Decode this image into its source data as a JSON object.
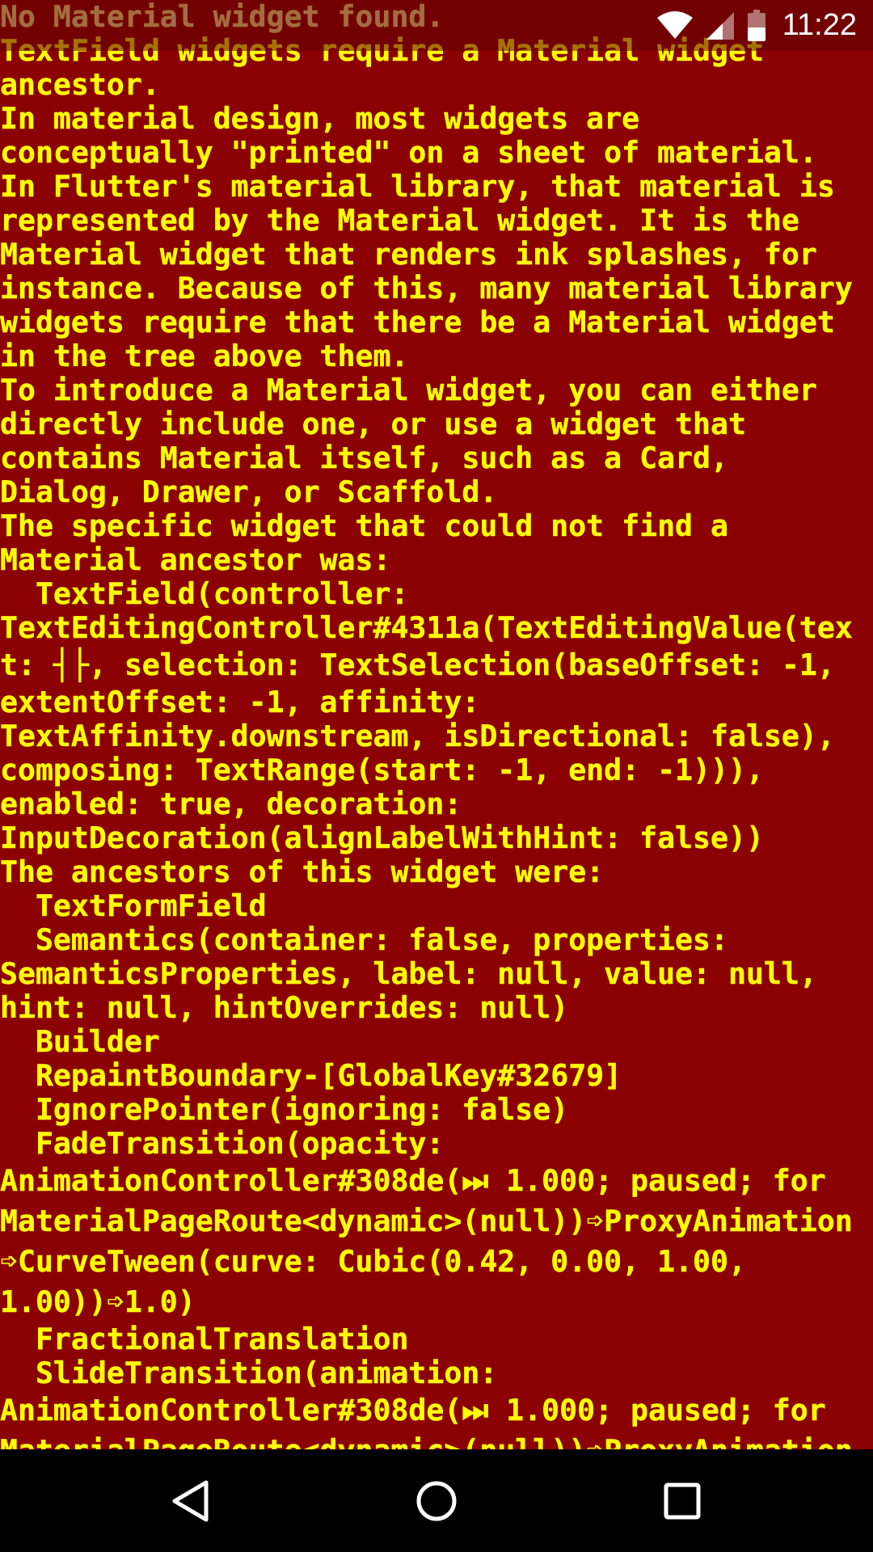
{
  "status_bar": {
    "time": "11:22",
    "icons": [
      "wifi-icon",
      "cell-signal-icon",
      "battery-icon"
    ]
  },
  "error": {
    "lines": [
      "No Material widget found.",
      "TextField widgets require a Material widget",
      "ancestor.",
      "In material design, most widgets are",
      "conceptually \"printed\" on a sheet of material.",
      "In Flutter's material library, that material is",
      "represented by the Material widget. It is the",
      "Material widget that renders ink splashes, for",
      "instance. Because of this, many material library",
      "widgets require that there be a Material widget",
      "in the tree above them.",
      "To introduce a Material widget, you can either",
      "directly include one, or use a widget that",
      "contains Material itself, such as a Card,",
      "Dialog, Drawer, or Scaffold.",
      "The specific widget that could not find a",
      "Material ancestor was:",
      "  TextField(controller:",
      "TextEditingController#4311a(TextEditingValue(tex",
      "t: ┤├, selection: TextSelection(baseOffset: -1,",
      "extentOffset: -1, affinity:",
      "TextAffinity.downstream, isDirectional: false),",
      "composing: TextRange(start: -1, end: -1))),",
      "enabled: true, decoration:",
      "InputDecoration(alignLabelWithHint: false))",
      "The ancestors of this widget were:",
      "  TextFormField",
      "  Semantics(container: false, properties:",
      "SemanticsProperties, label: null, value: null,",
      "hint: null, hintOverrides: null)",
      "  Builder",
      "  RepaintBoundary-[GlobalKey#32679]",
      "  IgnorePointer(ignoring: false)",
      "  FadeTransition(opacity:",
      "AnimationController#308de(⏭ 1.000; paused; for",
      "MaterialPageRoute<dynamic>(null))➩ProxyAnimation",
      "➩CurveTween(curve: Cubic(0.42, 0.00, 1.00,",
      "1.00))➩1.0)",
      "  FractionalTranslation",
      "  SlideTransition(animation:",
      "AnimationController#308de(⏭ 1.000; paused; for",
      "MaterialPageRoute<dynamic>(null))➩ProxyAnimation"
    ]
  },
  "navigation": {
    "buttons": [
      "back-icon",
      "home-icon",
      "recents-icon"
    ]
  },
  "colors": {
    "background": "#8b0000",
    "text": "#ffff00",
    "nav_bar": "#000000",
    "status_text": "#ffffff"
  }
}
